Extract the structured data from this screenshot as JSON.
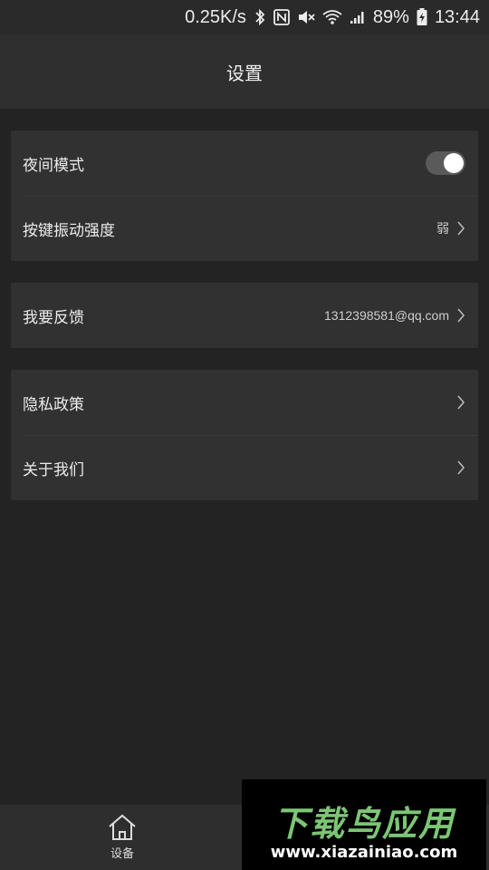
{
  "status_bar": {
    "speed": "0.25K/s",
    "battery": "89%",
    "time": "13:44",
    "icons": [
      "bluetooth-icon",
      "nfc-icon",
      "mute-icon",
      "wifi-icon",
      "signal-icon",
      "battery-charging-icon"
    ]
  },
  "header": {
    "title": "设置"
  },
  "settings": {
    "night_mode": {
      "label": "夜间模式",
      "enabled": true
    },
    "vibration": {
      "label": "按键振动强度",
      "value": "弱"
    },
    "feedback": {
      "label": "我要反馈",
      "value": "1312398581@qq.com"
    },
    "privacy": {
      "label": "隐私政策"
    },
    "about": {
      "label": "关于我们"
    }
  },
  "bottom_nav": {
    "items": [
      {
        "label": "设备",
        "icon": "home-icon"
      }
    ]
  },
  "watermark": {
    "title": "下载鸟应用",
    "url": "www.xiazainiao.com"
  },
  "colors": {
    "background": "#232323",
    "card": "#313131",
    "header": "#2f2f2f",
    "watermark_green": "#7cc576"
  }
}
